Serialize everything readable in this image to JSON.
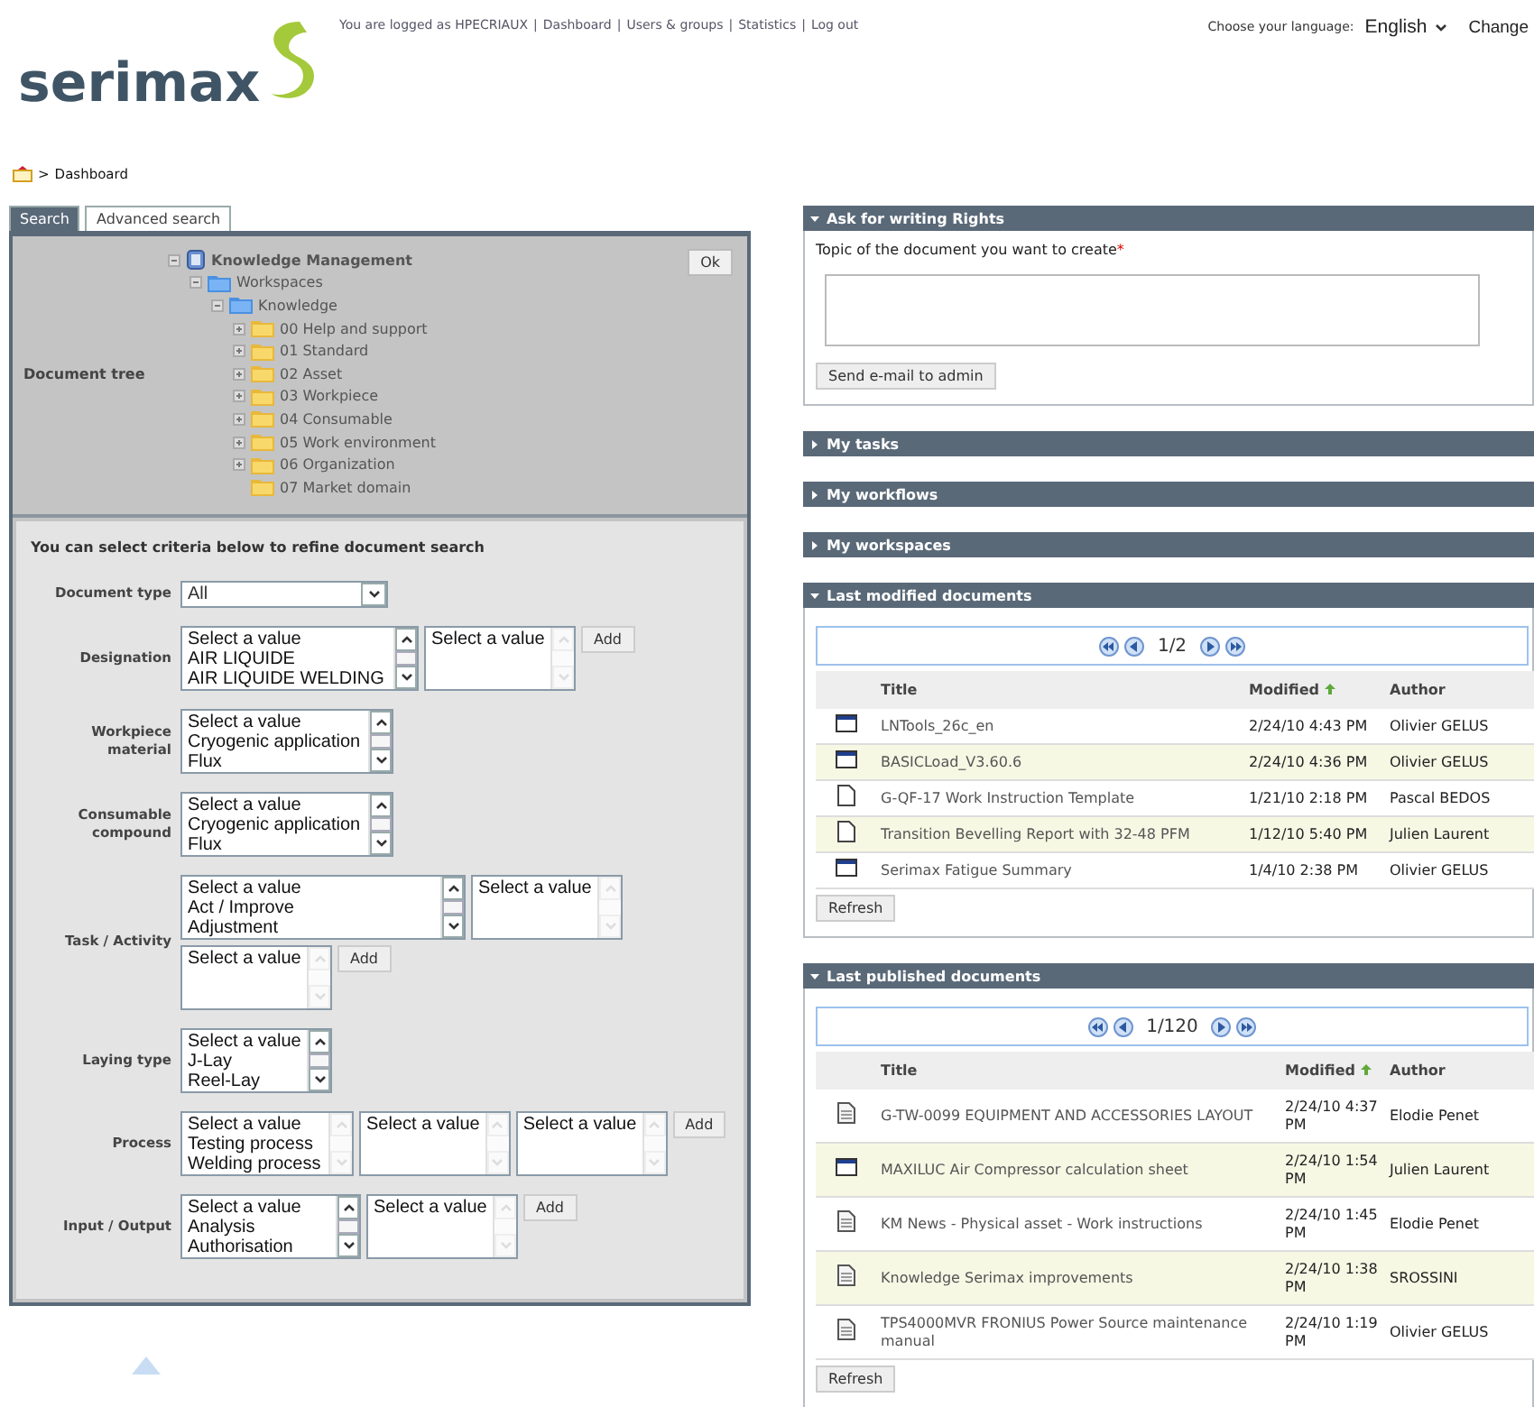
{
  "header": {
    "logo": "serimax",
    "user_text": "You are logged as HPECRIAUX",
    "separator": "|",
    "links": [
      "Dashboard",
      "Users & groups",
      "Statistics",
      "Log out"
    ],
    "language": {
      "label": "Choose your language:",
      "value": "English",
      "action": "Change"
    }
  },
  "breadcrumb": {
    "separator": ">",
    "current": "Dashboard"
  },
  "search_panel": {
    "tabs": [
      {
        "label": "Search",
        "selected": true
      },
      {
        "label": "Advanced search",
        "selected": false
      }
    ],
    "tree_label": "Document tree",
    "ok_button": "Ok",
    "tree": [
      {
        "label": "Knowledge Management",
        "kind": "database",
        "expanded": true,
        "children": [
          {
            "label": "Workspaces",
            "kind": "workspace",
            "expanded": true,
            "children": [
              {
                "label": "Knowledge",
                "kind": "workspace",
                "expanded": true,
                "children": [
                  {
                    "label": "00 Help and support",
                    "kind": "folder",
                    "expanded": false
                  },
                  {
                    "label": "01 Standard",
                    "kind": "folder",
                    "expanded": false
                  },
                  {
                    "label": "02 Asset",
                    "kind": "folder",
                    "expanded": false
                  },
                  {
                    "label": "03 Workpiece",
                    "kind": "folder",
                    "expanded": false
                  },
                  {
                    "label": "04 Consumable",
                    "kind": "folder",
                    "expanded": false
                  },
                  {
                    "label": "05 Work environment",
                    "kind": "folder",
                    "expanded": false
                  },
                  {
                    "label": "06 Organization",
                    "kind": "folder",
                    "expanded": false
                  },
                  {
                    "label": "07 Market domain",
                    "kind": "leaf_folder"
                  }
                ]
              }
            ]
          }
        ]
      }
    ],
    "criteria_title": "You can select criteria below to refine document search",
    "criteria": [
      {
        "label": "Document type",
        "controls": [
          {
            "kind": "select",
            "value": "All"
          }
        ]
      },
      {
        "label": "Designation",
        "controls": [
          {
            "kind": "listbox",
            "scrollable": true,
            "options": [
              "Select a value",
              "AIR LIQUIDE",
              "AIR LIQUIDE WELDING"
            ]
          },
          {
            "kind": "listbox",
            "scrollable": false,
            "options": [
              "Select a value"
            ]
          },
          {
            "kind": "button",
            "label": "Add"
          }
        ]
      },
      {
        "label": "Workpiece material",
        "controls": [
          {
            "kind": "listbox",
            "scrollable": true,
            "options": [
              "Select a value",
              "Cryogenic application",
              "Flux"
            ]
          }
        ]
      },
      {
        "label": "Consumable compound",
        "controls": [
          {
            "kind": "listbox",
            "scrollable": true,
            "options": [
              "Select a value",
              "Cryogenic application",
              "Flux"
            ]
          }
        ]
      },
      {
        "label": "Task / Activity",
        "controls": [
          {
            "kind": "listbox",
            "scrollable": true,
            "options": [
              "Select a value",
              "Act / Improve",
              "Adjustment"
            ]
          },
          {
            "kind": "listbox",
            "scrollable": false,
            "options": [
              "Select a value"
            ]
          },
          {
            "kind": "listbox",
            "scrollable": false,
            "options": [
              "Select a value"
            ]
          },
          {
            "kind": "button",
            "label": "Add"
          }
        ]
      },
      {
        "label": "Laying type",
        "controls": [
          {
            "kind": "listbox",
            "scrollable": true,
            "options": [
              "Select a value",
              "J-Lay",
              "Reel-Lay"
            ]
          }
        ]
      },
      {
        "label": "Process",
        "controls": [
          {
            "kind": "listbox",
            "scrollable": false,
            "options": [
              "Select a value",
              "Testing process",
              "Welding process"
            ]
          },
          {
            "kind": "listbox",
            "scrollable": false,
            "options": [
              "Select a value"
            ]
          },
          {
            "kind": "listbox",
            "scrollable": false,
            "options": [
              "Select a value"
            ]
          },
          {
            "kind": "button",
            "label": "Add"
          }
        ]
      },
      {
        "label": "Input / Output",
        "controls": [
          {
            "kind": "listbox",
            "scrollable": true,
            "options": [
              "Select a value",
              "Analysis",
              "Authorisation"
            ]
          },
          {
            "kind": "listbox",
            "scrollable": false,
            "options": [
              "Select a value"
            ]
          },
          {
            "kind": "button",
            "label": "Add"
          }
        ]
      }
    ]
  },
  "panels": [
    {
      "title": "Ask for writing Rights",
      "expanded": true,
      "kind": "request",
      "field_label": "Topic of the document you want to create",
      "required_mark": "*",
      "button": "Send e-mail to admin"
    },
    {
      "title": "My tasks",
      "expanded": false
    },
    {
      "title": "My workflows",
      "expanded": false
    },
    {
      "title": "My workspaces",
      "expanded": false
    },
    {
      "title": "Last modified documents",
      "expanded": true,
      "kind": "documents",
      "pager": "1/2",
      "columns": [
        {
          "label": "Title",
          "sorted": false
        },
        {
          "label": "Modified",
          "sorted": true
        },
        {
          "label": "Author",
          "sorted": false
        }
      ],
      "button": "Refresh",
      "rows": [
        {
          "kind": "window",
          "title": "LNTools_26c_en",
          "modified": "2/24/10 4:43 PM",
          "author": "Olivier GELUS"
        },
        {
          "kind": "window",
          "title": "BASICLoad_V3.60.6",
          "modified": "2/24/10 4:36 PM",
          "author": "Olivier GELUS"
        },
        {
          "kind": "blank",
          "title": "G-QF-17 Work Instruction Template",
          "modified": "1/21/10 2:18 PM",
          "author": "Pascal BEDOS"
        },
        {
          "kind": "blank",
          "title": "Transition Bevelling Report with 32-48 PFM",
          "modified": "1/12/10 5:40 PM",
          "author": "Julien Laurent"
        },
        {
          "kind": "window",
          "title": "Serimax Fatigue Summary",
          "modified": "1/4/10 2:38 PM",
          "author": "Olivier GELUS"
        }
      ]
    },
    {
      "title": "Last published documents",
      "expanded": true,
      "kind": "documents",
      "pager": "1/120",
      "columns": [
        {
          "label": "Title",
          "sorted": false
        },
        {
          "label": "Modified",
          "sorted": true
        },
        {
          "label": "Author",
          "sorted": false
        }
      ],
      "button": "Refresh",
      "rows": [
        {
          "kind": "lines",
          "title": "G-TW-0099 EQUIPMENT AND ACCESSORIES LAYOUT",
          "modified": "2/24/10 4:37 PM",
          "author": "Elodie Penet"
        },
        {
          "kind": "window",
          "title": "MAXILUC Air Compressor calculation sheet",
          "modified": "2/24/10 1:54 PM",
          "author": "Julien Laurent"
        },
        {
          "kind": "lines",
          "title": "KM News - Physical asset - Work instructions",
          "modified": "2/24/10 1:45 PM",
          "author": "Elodie Penet"
        },
        {
          "kind": "lines",
          "title": "Knowledge Serimax improvements",
          "modified": "2/24/10 1:38 PM",
          "author": "SROSSINI"
        },
        {
          "kind": "lines",
          "title": "TPS4000MVR FRONIUS Power Source maintenance manual",
          "modified": "2/24/10 1:19 PM",
          "author": "Olivier GELUS"
        }
      ]
    }
  ]
}
